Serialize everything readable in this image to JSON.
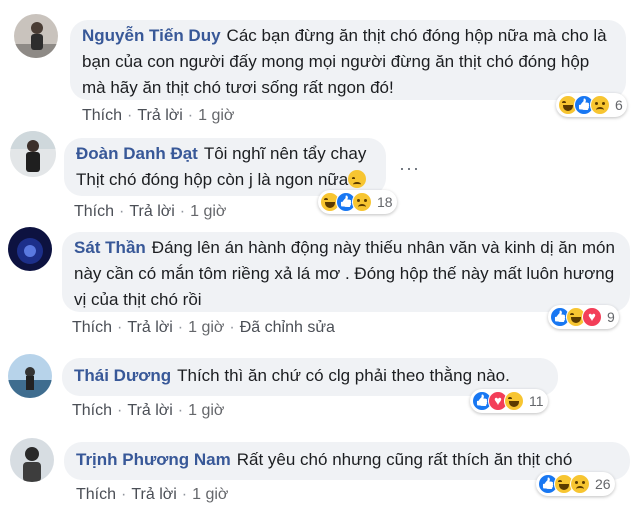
{
  "comments": [
    {
      "author": "Nguyễn Tiến Duy",
      "text": "Các bạn đừng ăn thịt chó đóng hộp nữa mà cho là bạn của con người đấy mong mọi người đừng ăn thịt chó đóng hộp mà hãy ăn thịt chó tươi sống rất ngon đó!",
      "like_label": "Thích",
      "reply_label": "Trả lời",
      "time": "1 giờ",
      "reaction_count": "6",
      "reactions": [
        "haha-icon",
        "like-icon",
        "sad-icon"
      ]
    },
    {
      "author": "Đoàn Danh Đạt",
      "text": "Tôi nghĩ nên tẩy chay Thịt chó đóng hộp còn j là ngon nữa",
      "inline_emoji": "disappointed-emoji-icon",
      "like_label": "Thích",
      "reply_label": "Trả lời",
      "time": "1 giờ",
      "reaction_count": "18",
      "reactions": [
        "haha-icon",
        "like-icon",
        "sad-icon"
      ],
      "more_icon": "more-options-icon"
    },
    {
      "author": "Sát Thần",
      "text": "Đáng lên án hành động này thiếu nhân văn và kinh dị ăn món này cần có mắn tôm riềng xả lá mơ . Đóng hộp thế này mất luôn hương vị của thịt chó rồi",
      "like_label": "Thích",
      "reply_label": "Trả lời",
      "time": "1 giờ",
      "edited_label": "Đã chỉnh sửa",
      "reaction_count": "9",
      "reactions": [
        "like-icon",
        "haha-icon",
        "love-icon"
      ]
    },
    {
      "author": "Thái Dương",
      "text": "Thích thì ăn chứ có clg phải theo thằng nào.",
      "like_label": "Thích",
      "reply_label": "Trả lời",
      "time": "1 giờ",
      "reaction_count": "11",
      "reactions": [
        "like-icon",
        "love-icon",
        "haha-icon"
      ]
    },
    {
      "author": "Trịnh Phương Nam",
      "text": "Rất yêu chó nhưng cũng rất thích ăn thịt chó",
      "like_label": "Thích",
      "reply_label": "Trả lời",
      "time": "1 giờ",
      "reaction_count": "26",
      "reactions": [
        "like-icon",
        "haha-icon",
        "sad-icon"
      ]
    }
  ],
  "colors": {
    "bubble": "#f0f2f5",
    "author": "#385898",
    "meta": "#65676b",
    "like_blue": "#1877f2",
    "love_red": "#f33e58",
    "haha_yellow": "#f7c531"
  }
}
